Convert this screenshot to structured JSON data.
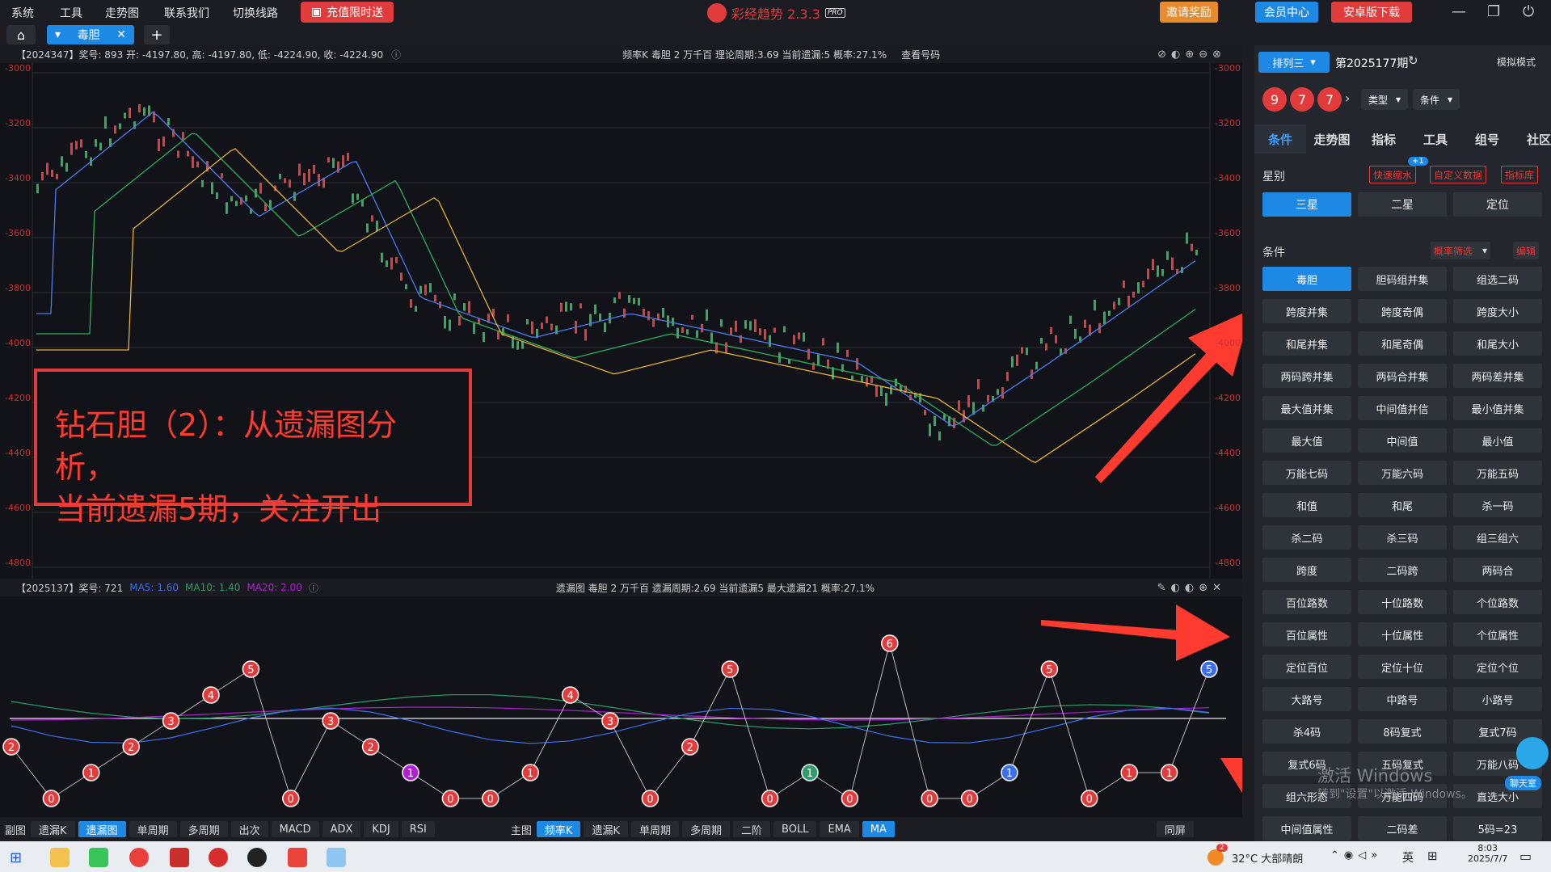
{
  "menu": [
    "系统",
    "工具",
    "走势图",
    "联系我们",
    "切换线路"
  ],
  "promo": "充值限时送",
  "app": {
    "name": "彩经趋势 2.3.3",
    "badge": "PRO"
  },
  "top_buttons": {
    "invite": "邀请奖励",
    "member": "会员中心",
    "android": "安卓版下载"
  },
  "tab": {
    "label": "毒胆"
  },
  "main_info": {
    "text": "【2024347】奖号: 893  开: -4197.80, 高: -4197.80, 低: -4224.90, 收: -4224.90",
    "center": "频率K  毒胆  2  万千百  理论周期:3.69  当前遗漏:5  概率:27.1%",
    "check": "查看号码"
  },
  "y_axis": [
    "-3000",
    "-3200",
    "-3400",
    "-3600",
    "-3800",
    "-4000",
    "-4200",
    "-4400",
    "-4600",
    "-4800"
  ],
  "annotation": {
    "line1": "钻石胆（2）：从遗漏图分析，",
    "line2": "当前遗漏5期，关注开出"
  },
  "sub_info": {
    "left": "【2025137】奖号: 721",
    "ma5": "MA5: 1.60",
    "ma10": "MA10: 1.40",
    "ma20": "MA20: 2.00",
    "center": "遗漏图  毒胆  2  万千百  遗漏周期:2.69  当前遗漏5  最大遗漏21  概率:27.1%"
  },
  "bottom_left": {
    "label": "副图",
    "items": [
      "遗漏K",
      "遗漏图",
      "单周期",
      "多周期",
      "出次",
      "MACD",
      "ADX",
      "KDJ",
      "RSI"
    ],
    "active": 1
  },
  "bottom_main": {
    "label": "主图",
    "items": [
      "频率K",
      "遗漏K",
      "单周期",
      "多周期",
      "二阶",
      "BOLL",
      "EMA",
      "MA"
    ],
    "active": [
      0,
      7
    ]
  },
  "bottom_right": "同屏",
  "right": {
    "lottery": "排列三",
    "period": "第2025177期",
    "mode": "模拟模式",
    "balls": [
      "9",
      "7",
      "7"
    ],
    "type": "类型",
    "cond": "条件",
    "tabs": [
      "条件",
      "走势图",
      "指标",
      "工具",
      "组号",
      "社区"
    ],
    "star_label": "星别",
    "quick": "快速缩水",
    "custom": "自定义数据",
    "indlib": "指标库",
    "plus": "+1",
    "stars": [
      "三星",
      "二星",
      "定位"
    ],
    "cond_label": "条件",
    "prob": "概率筛选",
    "edit": "编辑"
  },
  "conditions": [
    "毒胆",
    "胆码组并集",
    "组选二码",
    "跨度并集",
    "跨度奇偶",
    "跨度大小",
    "和尾并集",
    "和尾奇偶",
    "和尾大小",
    "两码跨并集",
    "两码合并集",
    "两码差并集",
    "最大值并集",
    "中间值并信",
    "最小值并集",
    "最大值",
    "中间值",
    "最小值",
    "万能七码",
    "万能六码",
    "万能五码",
    "和值",
    "和尾",
    "杀一码",
    "杀二码",
    "杀三码",
    "组三组六",
    "跨度",
    "二码跨",
    "两码合",
    "百位路数",
    "十位路数",
    "个位路数",
    "百位属性",
    "十位属性",
    "个位属性",
    "定位百位",
    "定位十位",
    "定位个位",
    "大路号",
    "中路号",
    "小路号",
    "杀4码",
    "8码复式",
    "复式7码",
    "复式6码",
    "五码复式",
    "万能八码",
    "组六形态",
    "万能四码",
    "直选大小",
    "中间值属性",
    "二码差",
    "5码=23"
  ],
  "activate": {
    "line1": "激活 Windows",
    "line2": "转到\"设置\"以激活 Windows。"
  },
  "chat": "聊天室",
  "taskbar": {
    "weather": "32°C 大部晴朗",
    "lang": "英",
    "time": "8:03",
    "date": "2025/7/7",
    "notify": "2"
  },
  "miss_points": [
    "2",
    "0",
    "1",
    "2",
    "3",
    "4",
    "5",
    "0",
    "3",
    "2",
    "1",
    "0",
    "0",
    "1",
    "4",
    "3",
    "0",
    "2",
    "5",
    "0",
    "1",
    "0",
    "6",
    "0",
    "0",
    "1",
    "5",
    "0",
    "1",
    "1",
    "5"
  ],
  "colors": {
    "accent": "#1e88e5",
    "red": "#e23b3b",
    "purple": "#b31fd6",
    "green": "#2e9d6a",
    "blue": "#3b6ff0"
  }
}
